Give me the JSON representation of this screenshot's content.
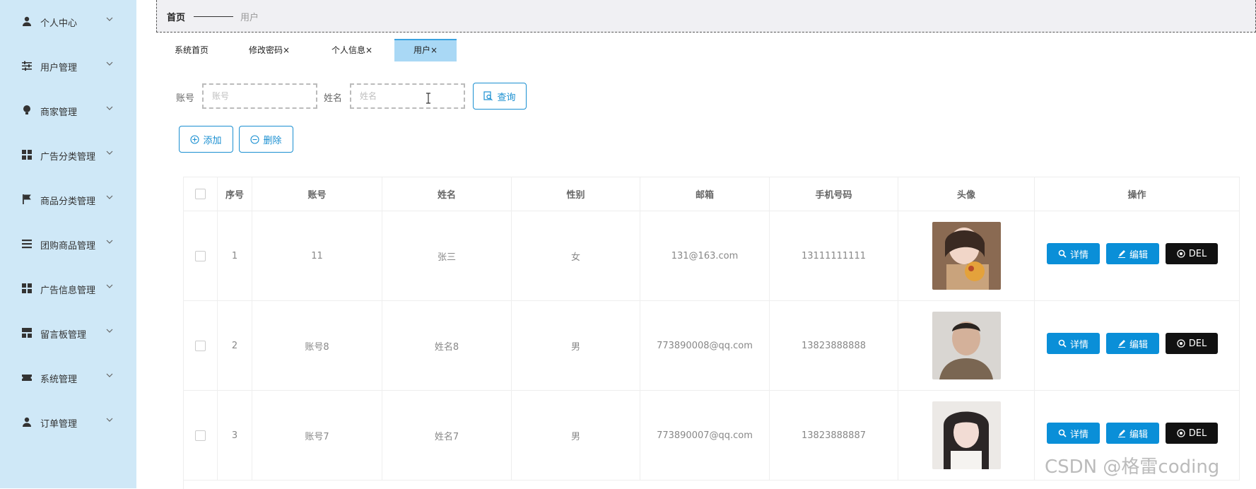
{
  "sidebar": {
    "items": [
      {
        "label": "个人中心",
        "icon": "user-icon"
      },
      {
        "label": "用户管理",
        "icon": "sliders-icon"
      },
      {
        "label": "商家管理",
        "icon": "bulb-icon"
      },
      {
        "label": "广告分类管理",
        "icon": "grid-icon"
      },
      {
        "label": "商品分类管理",
        "icon": "flag-icon"
      },
      {
        "label": "团购商品管理",
        "icon": "list-icon"
      },
      {
        "label": "广告信息管理",
        "icon": "grid-icon"
      },
      {
        "label": "留言板管理",
        "icon": "dashboard-icon"
      },
      {
        "label": "系统管理",
        "icon": "ticket-icon"
      },
      {
        "label": "订单管理",
        "icon": "user-icon"
      }
    ]
  },
  "breadcrumb": {
    "home": "首页",
    "current": "用户"
  },
  "tabs": [
    {
      "label": "系统首页"
    },
    {
      "label": "修改密码×"
    },
    {
      "label": "个人信息×"
    },
    {
      "label": "用户×"
    }
  ],
  "search": {
    "account_label": "账号",
    "account_placeholder": "账号",
    "account_value": "",
    "name_label": "姓名",
    "name_placeholder": "姓名",
    "name_value": "",
    "query_button": "查询"
  },
  "toolbar": {
    "add_label": "添加",
    "delete_label": "删除"
  },
  "table": {
    "columns": [
      "",
      "序号",
      "账号",
      "姓名",
      "性别",
      "邮箱",
      "手机号码",
      "头像",
      "操作"
    ],
    "rows": [
      {
        "index": "1",
        "account": "11",
        "name": "张三",
        "gender": "女",
        "email": "131@163.com",
        "phone": "13111111111",
        "avatar": "avatar-photo-1"
      },
      {
        "index": "2",
        "account": "账号8",
        "name": "姓名8",
        "gender": "男",
        "email": "773890008@qq.com",
        "phone": "13823888888",
        "avatar": "avatar-photo-2"
      },
      {
        "index": "3",
        "account": "账号7",
        "name": "姓名7",
        "gender": "男",
        "email": "773890007@qq.com",
        "phone": "13823888887",
        "avatar": "avatar-photo-3"
      }
    ],
    "actions": {
      "detail": "详情",
      "edit": "编辑",
      "del": "DEL"
    }
  },
  "watermark": "CSDN @格雷coding",
  "colors": {
    "sidebar_bg": "#cfe8f7",
    "accent": "#1a8fd1",
    "action_blue": "#0a8fd8",
    "del_black": "#111111",
    "active_tab": "#a9d8f5"
  }
}
